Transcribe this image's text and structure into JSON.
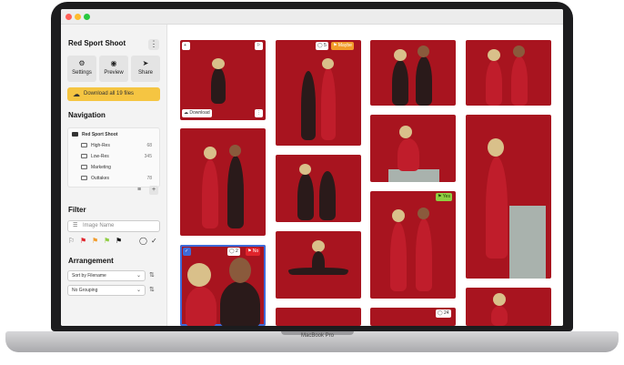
{
  "device": {
    "label": "MacBook Pro"
  },
  "sidebar": {
    "project_title": "Red Sport Shoot",
    "more_icon": "kebab-menu-icon",
    "toolbar": [
      {
        "label": "Settings",
        "icon": "gear-icon"
      },
      {
        "label": "Preview",
        "icon": "eye-icon"
      },
      {
        "label": "Share",
        "icon": "send-icon"
      }
    ],
    "download_label": "Download all 19 files",
    "navigation_heading": "Navigation",
    "tree": {
      "root": "Red Sport Shoot",
      "items": [
        {
          "label": "High-Res",
          "count": "68"
        },
        {
          "label": "Low-Res",
          "count": "345"
        },
        {
          "label": "Marketing",
          "count": ""
        },
        {
          "label": "Outtakes",
          "count": "78"
        }
      ]
    },
    "filter_heading": "Filter",
    "filter_placeholder": "Image Name",
    "arrangement_heading": "Arrangement",
    "sort_value": "Sort by Filename",
    "grouping_value": "No Grouping"
  },
  "gallery": {
    "overlays": {
      "download_label": "Download",
      "maybe_label": "Maybe",
      "maybe_count": "5",
      "yes_label": "Yes",
      "no_label": "No",
      "no_count": "2",
      "comment_count": "24"
    }
  },
  "colors": {
    "accent": "#f5c542",
    "backdrop": "#a8141f",
    "select": "#3f6ad8"
  }
}
